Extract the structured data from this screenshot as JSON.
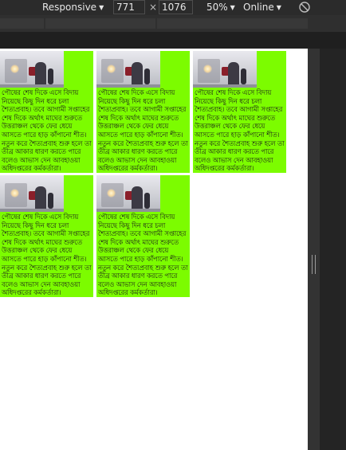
{
  "toolbar": {
    "device": "Responsive",
    "width": "771",
    "separator": "×",
    "height": "1076",
    "zoom": "50%",
    "throttle": "Online",
    "dropdown_icon": "triangle-down-icon",
    "rotate_icon": "rotate-icon"
  },
  "cards": [
    {
      "text": "পৌষের শেষ দিকে এসে বিদায় নিয়েছে কিছু দিন ধরে চলা শৈত্যপ্রবাহ। তবে আগামী সপ্তাহের শেষ দিকে অর্থাৎ মাঘের শুরুতে উত্তরাঞ্চল থেকে ফের ধেয়ে আসতে পারে হাড় কাঁপানো শীত। নতুন করে শৈত্যপ্রবাহ শুরু হলে তা তীব্র আকার ধারণ করতে পারে বলেও আভাস দেন আবহাওয়া অধিদপ্তরের কর্মকর্তারা।"
    },
    {
      "text": "পৌষের শেষ দিকে এসে বিদায় নিয়েছে কিছু দিন ধরে চলা শৈত্যপ্রবাহ। তবে আগামী সপ্তাহের শেষ দিকে অর্থাৎ মাঘের শুরুতে উত্তরাঞ্চল থেকে ফের ধেয়ে আসতে পারে হাড় কাঁপানো শীত। নতুন করে শৈত্যপ্রবাহ শুরু হলে তা তীব্র আকার ধারণ করতে পারে বলেও আভাস দেন আবহাওয়া অধিদপ্তরের কর্মকর্তারা।"
    },
    {
      "text": "পৌষের শেষ দিকে এসে বিদায় নিয়েছে কিছু দিন ধরে চলা শৈত্যপ্রবাহ। তবে আগামী সপ্তাহের শেষ দিকে অর্থাৎ মাঘের শুরুতে উত্তরাঞ্চল থেকে ফের ধেয়ে আসতে পারে হাড় কাঁপানো শীত। নতুন করে শৈত্যপ্রবাহ শুরু হলে তা তীব্র আকার ধারণ করতে পারে বলেও আভাস দেন আবহাওয়া অধিদপ্তরের কর্মকর্তারা।"
    },
    {
      "text": "পৌষের শেষ দিকে এসে বিদায় নিয়েছে কিছু দিন ধরে চলা শৈত্যপ্রবাহ। তবে আগামী সপ্তাহের শেষ দিকে অর্থাৎ মাঘের শুরুতে উত্তরাঞ্চল থেকে ফের ধেয়ে আসতে পারে হাড় কাঁপানো শীত। নতুন করে শৈত্যপ্রবাহ শুরু হলে তা তীব্র আকার ধারণ করতে পারে বলেও আভাস দেন আবহাওয়া অধিদপ্তরের কর্মকর্তারা।"
    },
    {
      "text": "পৌষের শেষ দিকে এসে বিদায় নিয়েছে কিছু দিন ধরে চলা শৈত্যপ্রবাহ। তবে আগামী সপ্তাহের শেষ দিকে অর্থাৎ মাঘের শুরুতে উত্তরাঞ্চল থেকে ফের ধেয়ে আসতে পারে হাড় কাঁপানো শীত। নতুন করে শৈত্যপ্রবাহ শুরু হলে তা তীব্র আকার ধারণ করতে পারে বলেও আভাস দেন আবহাওয়া অধিদপ্তরের কর্মকর্তারা।"
    }
  ],
  "colors": {
    "card_background": "#7cfc00",
    "page_background": "#ffffff",
    "devtools_background": "#242424"
  }
}
